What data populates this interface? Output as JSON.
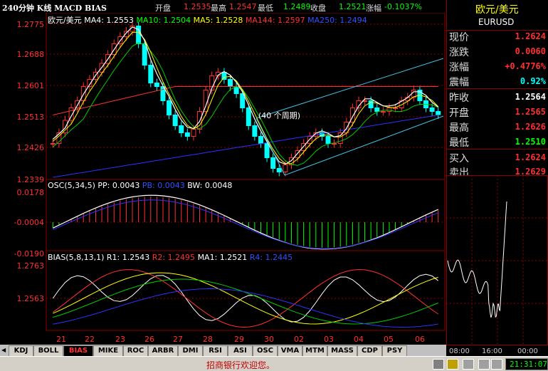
{
  "header": {
    "title": "240分钟 K线 MACD BIAS",
    "open_label": "开盘",
    "open_value": "1.2535",
    "high_label": "最高",
    "high_value": "1.2547",
    "low_label": "最低",
    "low_value": "1.2489",
    "close_label": "收盘",
    "close_value": "1.2521",
    "change_label": "涨幅",
    "change_value": "-0.1037%"
  },
  "kline": {
    "symbol": "欧元/美元",
    "ma4": "MA4: 1.2553",
    "ma10": "MA10: 1.2504",
    "ma5": "MA5: 1.2528",
    "ma144": "MA144: 1.2597",
    "ma250": "MA250: 1.2494",
    "annotation": "(40 个周期)",
    "axis_ticks": [
      "1.2775",
      "1.2688",
      "1.2601",
      "1.2513",
      "1.2426",
      "1.2339"
    ]
  },
  "osc": {
    "label": "OSC(5,34,5)",
    "pp": "PP: 0.0043",
    "pb": "PB: 0.0043",
    "bw": "BW: 0.0048",
    "axis_ticks": [
      "0.0178",
      "-0.0004",
      "-0.0190"
    ]
  },
  "bias": {
    "label": "BIAS(5,8,13,1)",
    "r1": "R1: 1.2543",
    "r2": "R2: 1.2495",
    "ma1": "MA1: 1.2521",
    "r4": "R4: 1.2445",
    "axis_ticks": [
      "1.2763",
      "1.2563"
    ]
  },
  "xaxis": [
    "21",
    "22",
    "23",
    "26",
    "27",
    "28",
    "29",
    "30",
    "02",
    "03",
    "04",
    "05",
    "06"
  ],
  "quote": {
    "name": "欧元/美元",
    "code": "EURUSD",
    "rows": [
      {
        "label": "现价",
        "value": "1.2624"
      },
      {
        "label": "涨跌",
        "value": "0.0060"
      },
      {
        "label": "涨幅",
        "value": "+0.4776%"
      },
      {
        "label": "震幅",
        "value": "0.92%"
      },
      {
        "label": "昨收",
        "value": "1.2564"
      },
      {
        "label": "开盘",
        "value": "1.2565"
      },
      {
        "label": "最高",
        "value": "1.2626"
      },
      {
        "label": "最低",
        "value": "1.2510"
      },
      {
        "label": "买入",
        "value": "1.2624"
      },
      {
        "label": "卖出",
        "value": "1.2629"
      }
    ],
    "intraday_times": [
      "08:00",
      "16:00",
      "00:00"
    ]
  },
  "tabs": [
    "KDJ",
    "BOLL",
    "BIAS",
    "MIKE",
    "ROC",
    "ARBR",
    "DMI",
    "RSI",
    "ASI",
    "OSC",
    "VMA",
    "MTM",
    "MASS",
    "CDP",
    "PSY"
  ],
  "active_tab": "BIAS",
  "status": {
    "message": "招商银行欢迎您。",
    "time": "21:31:07"
  },
  "colors": {
    "up": "#ff3030",
    "down": "#00ffff",
    "grid": "#8b0000",
    "ma4": "#ffffff",
    "ma10": "#00cc00",
    "ma5": "#ffff00",
    "ma144": "#ff3030",
    "ma250": "#3030ff"
  }
}
